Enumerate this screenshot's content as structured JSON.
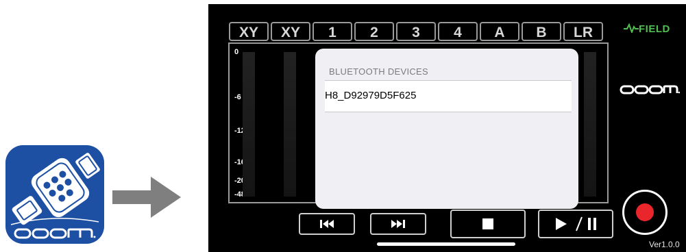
{
  "app_icon": {
    "brand": "zoom-logo",
    "color": "#1d4fa3"
  },
  "arrow": {
    "icon": "arrow-right-icon",
    "color": "#7f7f7f"
  },
  "channels": [
    "XY",
    "XY",
    "1",
    "2",
    "3",
    "4",
    "A",
    "B",
    "LR"
  ],
  "db_scale": [
    "0",
    "-6",
    "-12",
    "-16",
    "-20",
    "-48"
  ],
  "dialog": {
    "header": "BLUETOOTH DEVICES",
    "devices": [
      "H8_D92979D5F625"
    ]
  },
  "brand": {
    "field_label": "FIELD",
    "accent": "#4fbf4f"
  },
  "controls": {
    "rewind": "rewind-icon",
    "fast_forward": "fast-forward-icon",
    "stop": "stop-icon",
    "play_pause_label": "▶ / ❚❚"
  },
  "record": {
    "color": "#e8262b"
  },
  "version": "Ver1.0.0"
}
